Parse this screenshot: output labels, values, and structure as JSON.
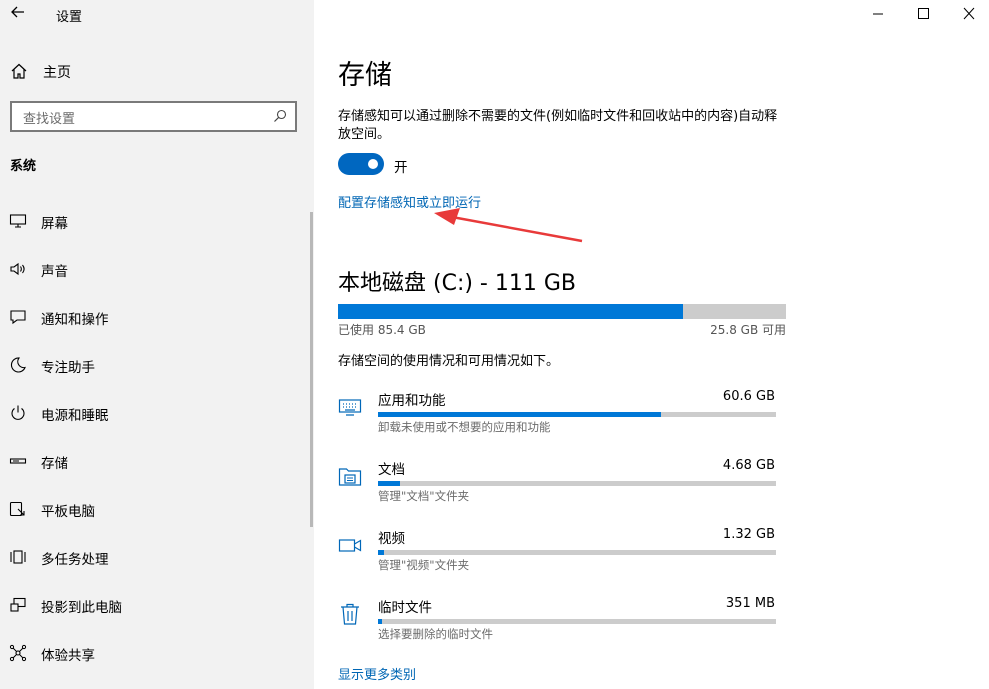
{
  "window": {
    "title": "设置",
    "back_icon": "back-arrow-icon",
    "controls": [
      "minimize-icon",
      "maximize-icon",
      "close-icon"
    ]
  },
  "sidebar": {
    "home_label": "主页",
    "search_placeholder": "查找设置",
    "section_title": "系统",
    "items": [
      {
        "label": "屏幕",
        "icon": "monitor-icon"
      },
      {
        "label": "声音",
        "icon": "speaker-icon"
      },
      {
        "label": "通知和操作",
        "icon": "notification-icon"
      },
      {
        "label": "专注助手",
        "icon": "moon-icon"
      },
      {
        "label": "电源和睡眠",
        "icon": "power-icon"
      },
      {
        "label": "存储",
        "icon": "storage-icon"
      },
      {
        "label": "平板电脑",
        "icon": "tablet-icon"
      },
      {
        "label": "多任务处理",
        "icon": "multitask-icon"
      },
      {
        "label": "投影到此电脑",
        "icon": "project-icon"
      },
      {
        "label": "体验共享",
        "icon": "share-icon"
      }
    ]
  },
  "main": {
    "title": "存储",
    "description": "存储感知可以通过删除不需要的文件(例如临时文件和回收站中的内容)自动释放空间。",
    "toggle_state": "开",
    "toggle_on": true,
    "configure_link": "配置存储感知或立即运行",
    "drive": {
      "title": "本地磁盘 (C:) - 111 GB",
      "used_label": "已使用 85.4 GB",
      "free_label": "25.8 GB 可用",
      "used_fraction": 0.77
    },
    "intro": "存储空间的使用情况和可用情况如下。",
    "categories": [
      {
        "name": "应用和功能",
        "size": "60.6 GB",
        "sub": "卸载未使用或不想要的应用和功能",
        "fraction": 0.71,
        "icon": "keyboard-icon"
      },
      {
        "name": "文档",
        "size": "4.68 GB",
        "sub": "管理\"文档\"文件夹",
        "fraction": 0.055,
        "icon": "folder-icon"
      },
      {
        "name": "视频",
        "size": "1.32 GB",
        "sub": "管理\"视频\"文件夹",
        "fraction": 0.015,
        "icon": "video-icon"
      },
      {
        "name": "临时文件",
        "size": "351 MB",
        "sub": "选择要删除的临时文件",
        "fraction": 0.005,
        "icon": "trash-icon"
      }
    ],
    "more_link": "显示更多类别"
  },
  "colors": {
    "accent": "#0078d7",
    "link": "#0066b4",
    "annotation_arrow": "#e83a3a"
  }
}
